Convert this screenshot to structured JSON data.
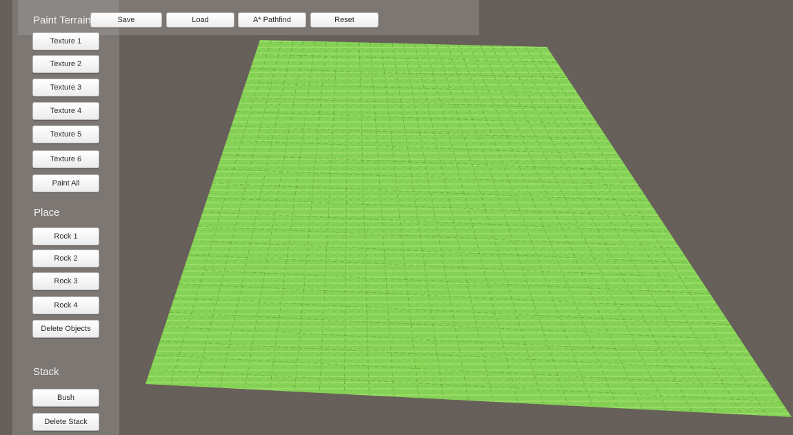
{
  "toolbar": {
    "title": "Paint Terrain",
    "save": "Save",
    "load": "Load",
    "pathfind": "A* Pathfind",
    "reset": "Reset"
  },
  "textures": {
    "t1": "Texture 1",
    "t2": "Texture 2",
    "t3": "Texture 3",
    "t4": "Texture 4",
    "t5": "Texture 5",
    "t6": "Texture 6",
    "paint_all": "Paint All"
  },
  "place": {
    "heading": "Place",
    "rock1": "Rock 1",
    "rock2": "Rock 2",
    "rock3": "Rock 3",
    "rock4": "Rock 4",
    "delete_objects": "Delete Objects"
  },
  "stack": {
    "heading": "Stack",
    "bush": "Bush",
    "delete_stack": "Delete Stack"
  },
  "scene": {
    "background_color": "#675f5a",
    "terrain_color": "#86d256",
    "grid_color": "#4f8a33"
  }
}
